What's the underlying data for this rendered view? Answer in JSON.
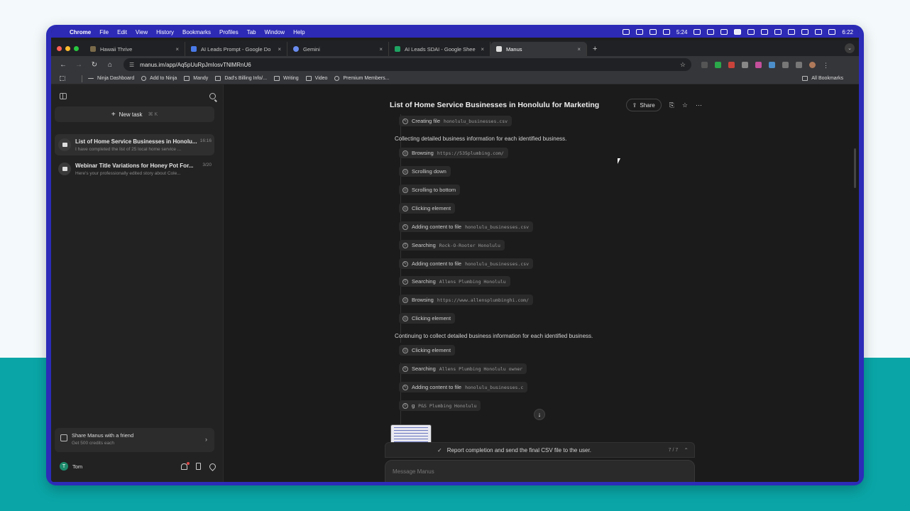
{
  "menubar": {
    "app": "Chrome",
    "items": [
      "File",
      "Edit",
      "View",
      "History",
      "Bookmarks",
      "Profiles",
      "Tab",
      "Window",
      "Help"
    ],
    "battery_time": "5:24",
    "clock": "6:22"
  },
  "tabs": [
    {
      "label": "Hawaii Thrive",
      "color": "#7a6a4a"
    },
    {
      "label": "AI Leads Prompt - Google Do",
      "color": "#4a7ae8"
    },
    {
      "label": "Gemini",
      "color": "#6a8cf0"
    },
    {
      "label": "AI Leads SDAI - Google Shee",
      "color": "#1ea362"
    },
    {
      "label": "Manus",
      "color": "#dddddd"
    }
  ],
  "address": {
    "url": "manus.im/app/Aq5pUuRpJmIosvTNlMRnU6"
  },
  "bookmarks": {
    "items": [
      {
        "label": "Ninja Dashboard",
        "icon": "line"
      },
      {
        "label": "Add to Ninja",
        "icon": "globe"
      },
      {
        "label": "Mandy",
        "icon": "folder"
      },
      {
        "label": "Dad's Billing Info/...",
        "icon": "folder"
      },
      {
        "label": "Writing",
        "icon": "folder"
      },
      {
        "label": "Video",
        "icon": "folder"
      },
      {
        "label": "Premium Members...",
        "icon": "globe"
      }
    ],
    "all": "All Bookmarks"
  },
  "sidebar": {
    "new_task": "New task",
    "shortcut": "⌘ K",
    "tasks": [
      {
        "title": "List of Home Service Businesses in Honolu...",
        "date": "16:16",
        "snippet": "I have completed the list of 25 local home service ..."
      },
      {
        "title": "Webinar Title Variations for Honey Pot For...",
        "date": "3/20",
        "snippet": "Here's your professionally edited story about Cole..."
      }
    ],
    "share": {
      "title": "Share Manus with a friend",
      "subtitle": "Get 500 credits each"
    },
    "user": {
      "initial": "T",
      "name": "Tom"
    }
  },
  "main": {
    "title": "List of Home Service Businesses in Honolulu for Marketing",
    "share_label": "Share",
    "steps": [
      {
        "icon": "file",
        "action": "Creating file",
        "arg": "honolulu_businesses.csv"
      },
      {
        "type": "note",
        "text": "Collecting detailed business information for each identified business."
      },
      {
        "icon": "browse",
        "action": "Browsing",
        "arg": "https://535plumbing.com/"
      },
      {
        "icon": "browse",
        "action": "Scrolling down",
        "arg": ""
      },
      {
        "icon": "browse",
        "action": "Scrolling to bottom",
        "arg": ""
      },
      {
        "icon": "browse",
        "action": "Clicking element",
        "arg": ""
      },
      {
        "icon": "file",
        "action": "Adding content to file",
        "arg": "honolulu_businesses.csv"
      },
      {
        "icon": "search",
        "action": "Searching",
        "arg": "Rock-O-Rooter Honolulu"
      },
      {
        "icon": "file",
        "action": "Adding content to file",
        "arg": "honolulu_businesses.csv"
      },
      {
        "icon": "search",
        "action": "Searching",
        "arg": "Allens Plumbing Honolulu"
      },
      {
        "icon": "browse",
        "action": "Browsing",
        "arg": "https://www.allensplumbinghi.com/"
      },
      {
        "icon": "browse",
        "action": "Clicking element",
        "arg": ""
      },
      {
        "type": "note",
        "text": "Continuing to collect detailed business information for each identified business."
      },
      {
        "icon": "browse",
        "action": "Clicking element",
        "arg": ""
      },
      {
        "icon": "search",
        "action": "Searching",
        "arg": "Allens Plumbing Honolulu owner"
      },
      {
        "icon": "file",
        "action": "Adding content to file",
        "arg": "honolulu_businesses.c"
      },
      {
        "icon": "search",
        "action": "g",
        "arg": "P&S Plumbing Honolulu"
      }
    ],
    "progress": {
      "text": "Report completion and send the final CSV file to the user.",
      "count": "7 / 7"
    },
    "composer_placeholder": "Message Manus"
  }
}
